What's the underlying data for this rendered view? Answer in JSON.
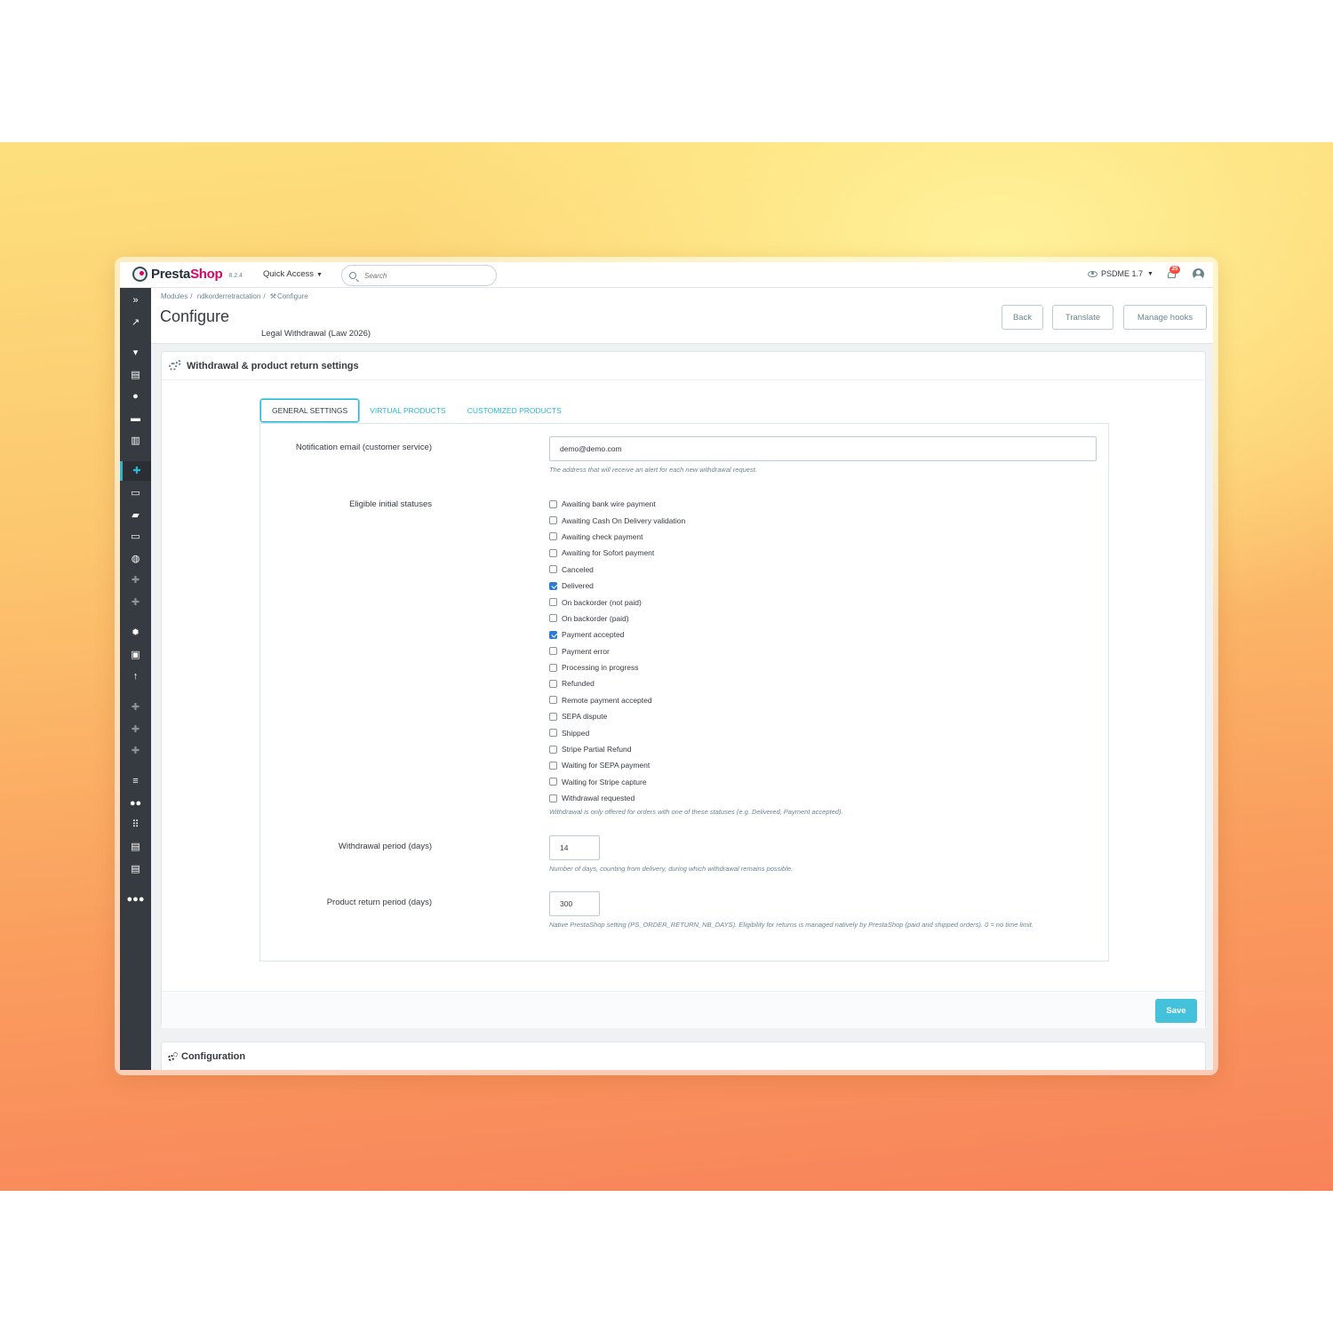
{
  "header": {
    "logo_presta": "Presta",
    "logo_shop": "Shop",
    "version": "8.2.4",
    "quick_access": "Quick Access",
    "search_placeholder": "Search",
    "shop_name": "PSDME 1.7",
    "notification_count": "25"
  },
  "sidebar": {
    "icons": [
      "chevrons-right-icon",
      "trending-up-icon",
      "shopping-basket-icon",
      "store-icon",
      "account-circle-icon",
      "chat-icon",
      "bar-chart-icon",
      "puzzle-icon",
      "desktop-icon",
      "truck-icon",
      "credit-card-icon",
      "globe-icon",
      "puzzle-icon",
      "puzzle-icon",
      "gear-icon",
      "settings-box-icon",
      "arrow-up-icon",
      "puzzle-icon",
      "puzzle-icon",
      "puzzle-icon",
      "tune-icon",
      "people-icon",
      "grid-icon",
      "toolbox-icon",
      "list-icon",
      "groups-icon"
    ],
    "active_index": 7
  },
  "breadcrumb": {
    "items": [
      "Modules",
      "ndkorderretractation",
      "Configure"
    ]
  },
  "page": {
    "title": "Configure",
    "module_name": "Legal Withdrawal (Law 2026)"
  },
  "toolbar": {
    "back": "Back",
    "translate": "Translate",
    "manage_hooks": "Manage hooks"
  },
  "panel": {
    "title": "Withdrawal & product return settings",
    "tabs": [
      "GENERAL SETTINGS",
      "VIRTUAL PRODUCTS",
      "CUSTOMIZED PRODUCTS"
    ],
    "active_tab": 0,
    "email": {
      "label": "Notification email (customer service)",
      "value": "demo@demo.com",
      "help": "The address that will receive an alert for each new withdrawal request."
    },
    "statuses": {
      "label": "Eligible initial statuses",
      "options": [
        {
          "label": "Awaiting bank wire payment",
          "checked": false
        },
        {
          "label": "Awaiting Cash On Delivery validation",
          "checked": false
        },
        {
          "label": "Awaiting check payment",
          "checked": false
        },
        {
          "label": "Awaiting for Sofort payment",
          "checked": false
        },
        {
          "label": "Canceled",
          "checked": false
        },
        {
          "label": "Delivered",
          "checked": true
        },
        {
          "label": "On backorder (not paid)",
          "checked": false
        },
        {
          "label": "On backorder (paid)",
          "checked": false
        },
        {
          "label": "Payment accepted",
          "checked": true
        },
        {
          "label": "Payment error",
          "checked": false
        },
        {
          "label": "Processing in progress",
          "checked": false
        },
        {
          "label": "Refunded",
          "checked": false
        },
        {
          "label": "Remote payment accepted",
          "checked": false
        },
        {
          "label": "SEPA dispute",
          "checked": false
        },
        {
          "label": "Shipped",
          "checked": false
        },
        {
          "label": "Stripe Partial Refund",
          "checked": false
        },
        {
          "label": "Waiting for SEPA payment",
          "checked": false
        },
        {
          "label": "Waiting for Stripe capture",
          "checked": false
        },
        {
          "label": "Withdrawal requested",
          "checked": false
        }
      ],
      "help": "Withdrawal is only offered for orders with one of these statuses (e.g. Delivered, Payment accepted)."
    },
    "withdrawal_period": {
      "label": "Withdrawal period (days)",
      "value": "14",
      "help": "Number of days, counting from delivery, during which withdrawal remains possible."
    },
    "return_period": {
      "label": "Product return period (days)",
      "value": "300",
      "help": "Native PrestaShop setting (PS_ORDER_RETURN_NB_DAYS). Eligibility for returns is managed natively by PrestaShop (paid and shipped orders). 0 = no time limit."
    },
    "save": "Save"
  },
  "panel2": {
    "title": "Configuration"
  }
}
